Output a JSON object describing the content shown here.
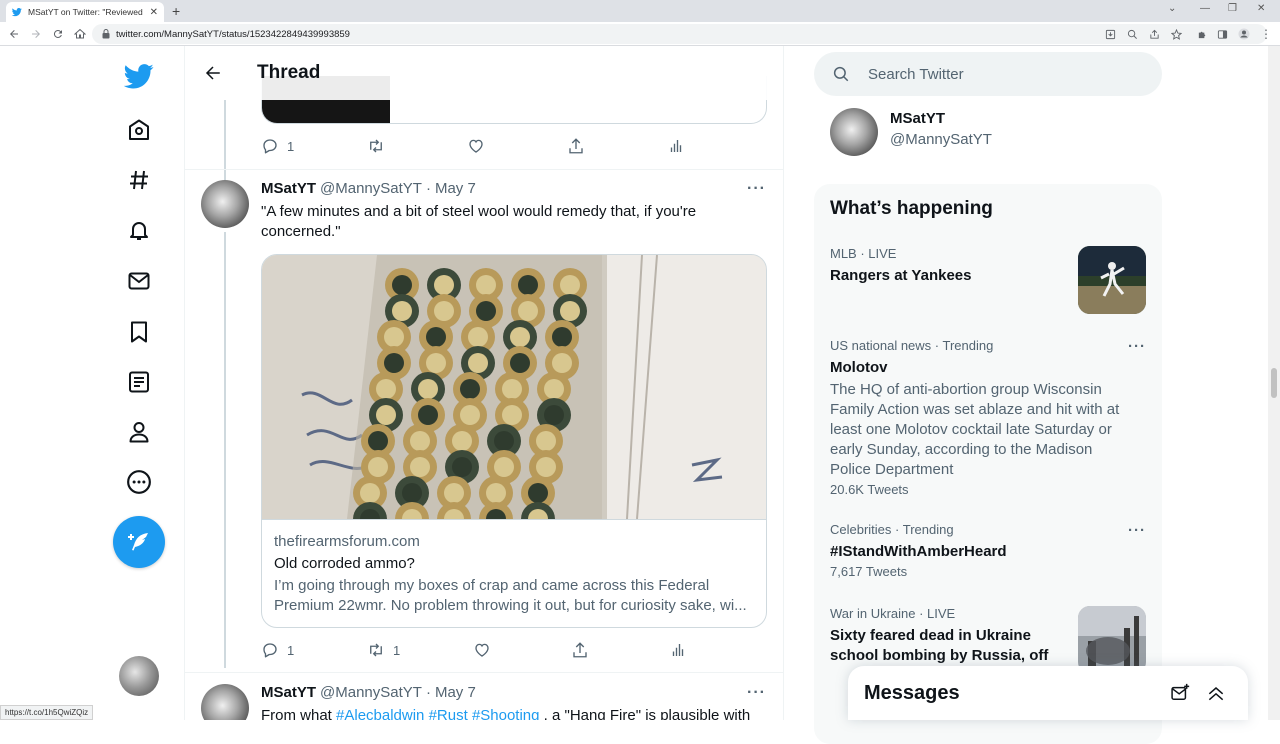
{
  "browser": {
    "tab_title": "MSatYT on Twitter: \"Reviewed l...",
    "url": "twitter.com/MannySatYT/status/1523422849439993859",
    "status_bar_url": "https://t.co/1h5QwiZQiz"
  },
  "nav": {
    "icons": [
      "twitter-logo-icon",
      "home-icon",
      "explore-hashtag-icon",
      "notifications-bell-icon",
      "messages-envelope-icon",
      "bookmarks-icon",
      "lists-icon",
      "profile-icon",
      "more-icon",
      "tweet-compose-icon"
    ]
  },
  "header": {
    "title": "Thread"
  },
  "prev_tweet": {
    "replies": "1"
  },
  "tweet1": {
    "name": "MSatYT",
    "handle": "@MannySatYT",
    "dot": "·",
    "date": "May 7",
    "text": "\"A few minutes and a bit of steel wool would remedy that, if you're concerned.\"",
    "card": {
      "domain": "thefirearmsforum.com",
      "title": "Old corroded ammo?",
      "description": "I’m going through my boxes of crap and came across this Federal Premium 22wmr. No problem throwing it out, but for curiosity sake, wi..."
    },
    "replies": "1",
    "retweets": "1"
  },
  "tweet2": {
    "name": "MSatYT",
    "handle": "@MannySatYT",
    "dot": "·",
    "date": "May 7",
    "text_prefix": "From what ",
    "hashtag1": "#Alecbaldwin",
    "hashtag2": "#Rust",
    "hashtag3": "#Shooting",
    "text_suffix": " , a \"Hang Fire\" is plausible with"
  },
  "search": {
    "placeholder": "Search Twitter"
  },
  "profile": {
    "name": "MSatYT",
    "handle": "@MannySatYT"
  },
  "trends": {
    "title": "What’s happening",
    "items": [
      {
        "meta": "MLB · LIVE",
        "name": "Rangers at Yankees"
      },
      {
        "meta": "US national news · Trending",
        "name": "Molotov",
        "desc": "The HQ of anti-abortion group Wisconsin Family Action was set ablaze and hit with at least one Molotov cocktail late Saturday or early Sunday, according to the Madison Police Department",
        "count": "20.6K Tweets"
      },
      {
        "meta": "Celebrities · Trending",
        "name": "#IStandWithAmberHeard",
        "count": "7,617 Tweets"
      },
      {
        "meta": "War in Ukraine · LIVE",
        "name": "Sixty feared dead in Ukraine school bombing by Russia, off"
      }
    ]
  },
  "messages": {
    "title": "Messages"
  },
  "colors": {
    "accent": "#1d9bf0",
    "text": "#0f1419",
    "secondary": "#536471"
  }
}
